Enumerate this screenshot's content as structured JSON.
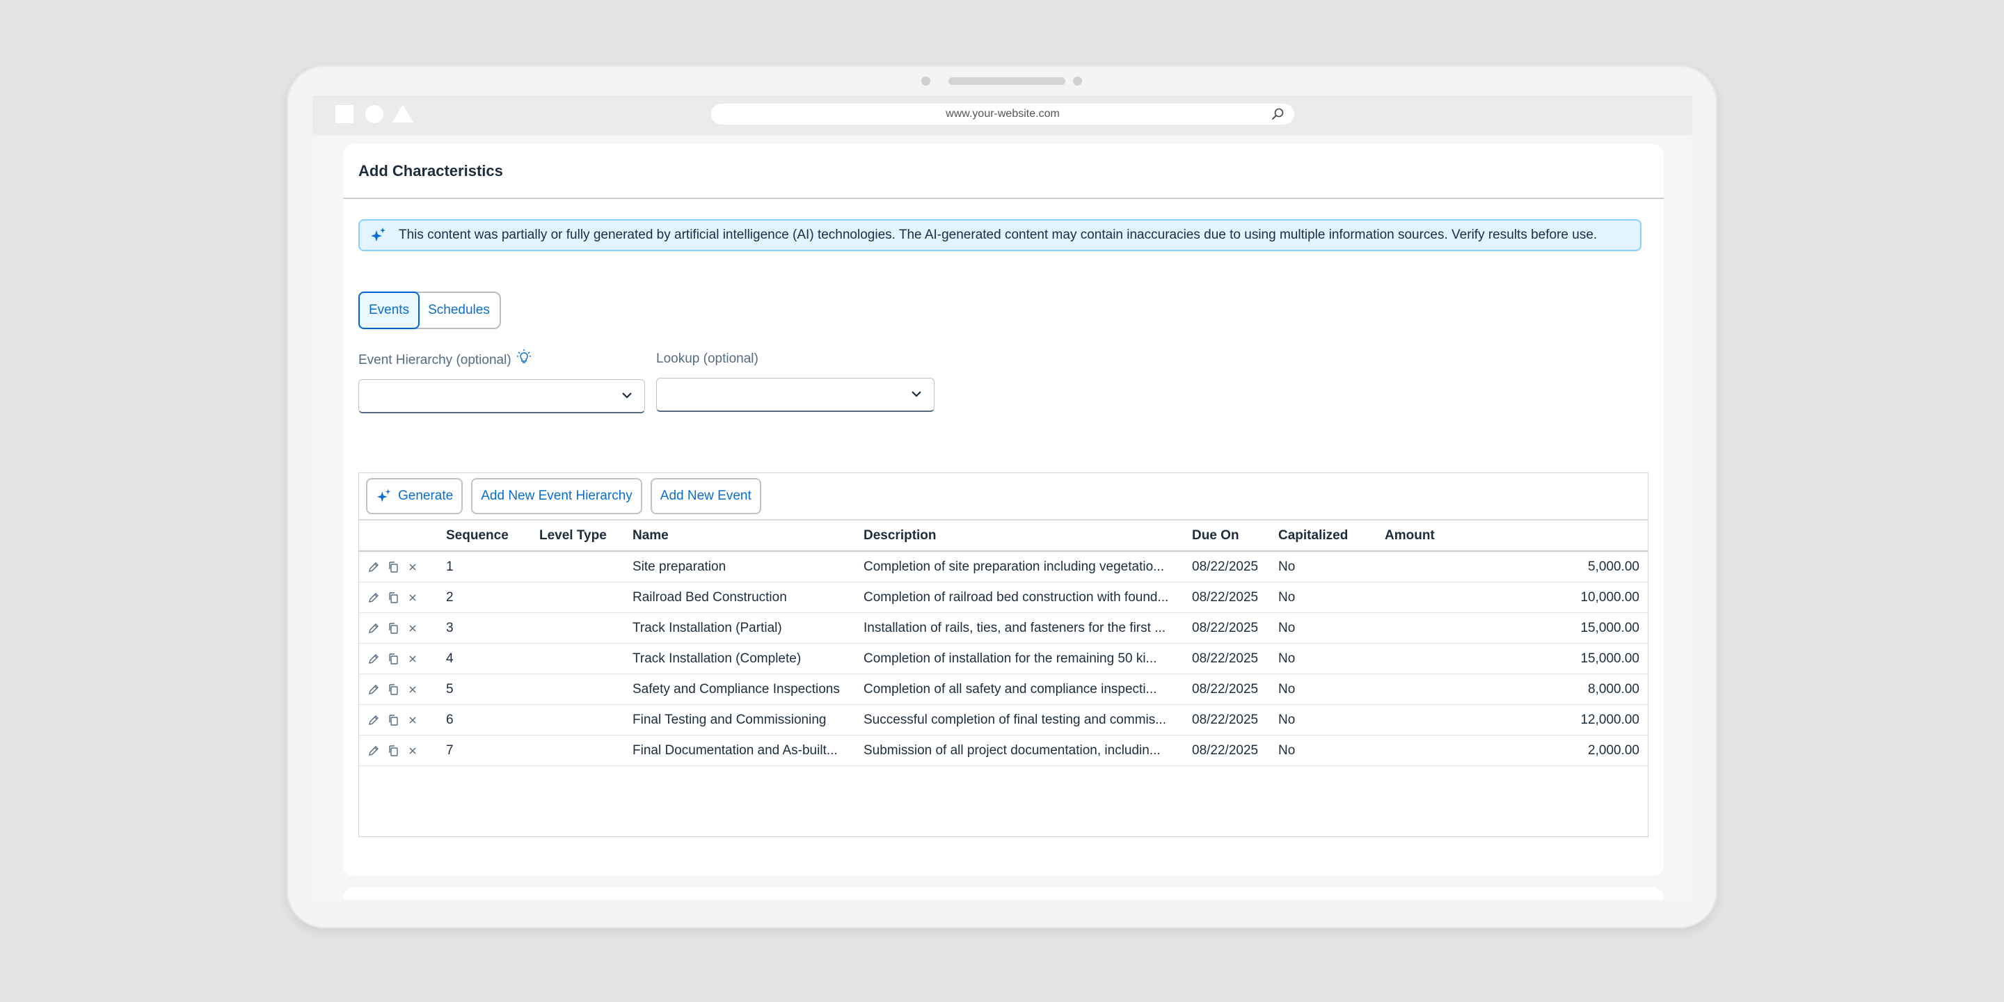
{
  "browser": {
    "url": "www.your-website.com"
  },
  "page": {
    "title": "Add Characteristics"
  },
  "ai_banner": {
    "text": "This content was partially or fully generated by artificial intelligence (AI) technologies. The AI-generated content may contain inaccuracies due to using multiple information sources. Verify results before use."
  },
  "tabs": [
    {
      "label": "Events",
      "active": true
    },
    {
      "label": "Schedules",
      "active": false
    }
  ],
  "filters": {
    "event_hierarchy_label": "Event Hierarchy (optional)",
    "event_hierarchy_value": "",
    "lookup_label": "Lookup (optional)",
    "lookup_value": ""
  },
  "toolbar": {
    "generate": "Generate",
    "add_hierarchy": "Add New Event Hierarchy",
    "add_event": "Add New Event"
  },
  "table": {
    "columns": [
      "Sequence",
      "Level Type",
      "Name",
      "Description",
      "Due On",
      "Capitalized",
      "Amount"
    ],
    "rows": [
      {
        "seq": "1",
        "level": "",
        "name": "Site preparation",
        "desc": "Completion of site preparation including vegetatio...",
        "due": "08/22/2025",
        "cap": "No",
        "amount": "5,000.00"
      },
      {
        "seq": "2",
        "level": "",
        "name": "Railroad Bed Construction",
        "desc": "Completion of railroad bed construction with found...",
        "due": "08/22/2025",
        "cap": "No",
        "amount": "10,000.00"
      },
      {
        "seq": "3",
        "level": "",
        "name": "Track Installation (Partial)",
        "desc": "Installation of rails, ties, and fasteners for the first ...",
        "due": "08/22/2025",
        "cap": "No",
        "amount": "15,000.00"
      },
      {
        "seq": "4",
        "level": "",
        "name": "Track Installation (Complete)",
        "desc": "Completion of installation for the remaining 50 ki...",
        "due": "08/22/2025",
        "cap": "No",
        "amount": "15,000.00"
      },
      {
        "seq": "5",
        "level": "",
        "name": "Safety and Compliance Inspections",
        "desc": "Completion of all safety and compliance inspecti...",
        "due": "08/22/2025",
        "cap": "No",
        "amount": "8,000.00"
      },
      {
        "seq": "6",
        "level": "",
        "name": "Final Testing and Commissioning",
        "desc": "Successful completion of final testing and commis...",
        "due": "08/22/2025",
        "cap": "No",
        "amount": "12,000.00"
      },
      {
        "seq": "7",
        "level": "",
        "name": "Final Documentation and As-built...",
        "desc": "Submission of all project documentation, includin...",
        "due": "08/22/2025",
        "cap": "No",
        "amount": "2,000.00"
      }
    ]
  },
  "colors": {
    "accent": "#0a6ed1",
    "banner_bg": "#e1f4ff",
    "banner_border": "#89d1ff"
  },
  "icons": [
    "search-icon",
    "ai-sparkle-icon",
    "lightbulb-icon",
    "chevron-down-icon",
    "edit-icon",
    "copy-icon",
    "delete-icon"
  ]
}
